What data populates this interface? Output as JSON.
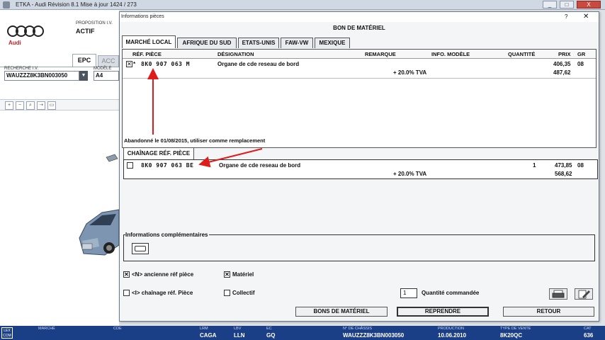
{
  "window": {
    "title": "ETKA - Audi Révision 8.1 Mise à jour 1424 / 273",
    "minimize": "_",
    "maximize": "□",
    "close": "X"
  },
  "background_app": {
    "brand": "Audi",
    "proposition_label": "PROPOSITION I.V.",
    "proposition_value": "ACTIF",
    "tabs": [
      "EPC",
      "ACC"
    ],
    "search_label": "RECHERCHE I.V.",
    "search_value": "WAUZZZ8K3BN003050",
    "model_label": "MODÈLE",
    "model_value": "A4"
  },
  "dialog": {
    "title": "Informations pièces",
    "help": "?",
    "close": "✕",
    "heading": "BON DE MATÉRIEL",
    "tabs": [
      "MARCHÉ LOCAL",
      "AFRIQUE DU SUD",
      "ETATS-UNIS",
      "FAW-VW",
      "MEXIQUE"
    ],
    "columns": {
      "ref": "RÉF. PIÈCE",
      "designation": "DÉSIGNATION",
      "remarque": "REMARQUE",
      "info_modele": "INFO. MODÈLE",
      "quantite": "QUANTITÉ",
      "prix": "PRIX",
      "gr": "GR"
    },
    "main_row": {
      "checked": "✕",
      "star": "*",
      "ref": "8K0 907 063 M",
      "designation": "Organe de cde reseau de bord",
      "quantity": "",
      "price": "406,35",
      "gr": "08",
      "tva_label": "+ 20.0% TVA",
      "price_tva": "487,62"
    },
    "abandoned_text": "Abandonné le 01/08/2015, utiliser comme remplacement",
    "chain_tab": "CHAÎNAGE RÉF. PIÈCE",
    "chain_row": {
      "ref": "8K0 907 063 BE",
      "designation": "Organe de cde reseau de bord",
      "quantity": "1",
      "price": "473,85",
      "gr": "08",
      "tva_label": "+ 20.0% TVA",
      "price_tva": "568,62"
    },
    "info_comp_label": "Informations complémentaires",
    "options": {
      "ancienne": "<N> ancienne réf pièce",
      "chainage": "<I> chaînage réf. Pièce",
      "materiel": "Matériel",
      "collectif": "Collectif"
    },
    "qty_value": "1",
    "qty_label": "Quantité commandée",
    "buttons": {
      "bons": "BONS DE MATÉRIEL",
      "reprendre": "REPRENDRE",
      "retour": "RETOUR"
    }
  },
  "status_bar": {
    "logo": "LEX COM",
    "fields": [
      {
        "label": "MARCHÉ",
        "value": ""
      },
      {
        "label": "CDE",
        "value": ""
      },
      {
        "label": "LRM",
        "value": "CAGA"
      },
      {
        "label": "LBV",
        "value": "LLN"
      },
      {
        "label": "EC",
        "value": "GQ"
      },
      {
        "label": "N° DE CHÂSSIS",
        "value": "WAUZZZ8K3BN003050"
      },
      {
        "label": "PRODUCTION",
        "value": "10.06.2010"
      },
      {
        "label": "TYPE DE VENTE",
        "value": "8K20QC"
      },
      {
        "label": "CAT",
        "value": "636"
      }
    ]
  },
  "colors": {
    "status_bar": "#1b3f86",
    "annotation_arrow": "#e01b1b",
    "audi_red": "#c81e1e"
  }
}
